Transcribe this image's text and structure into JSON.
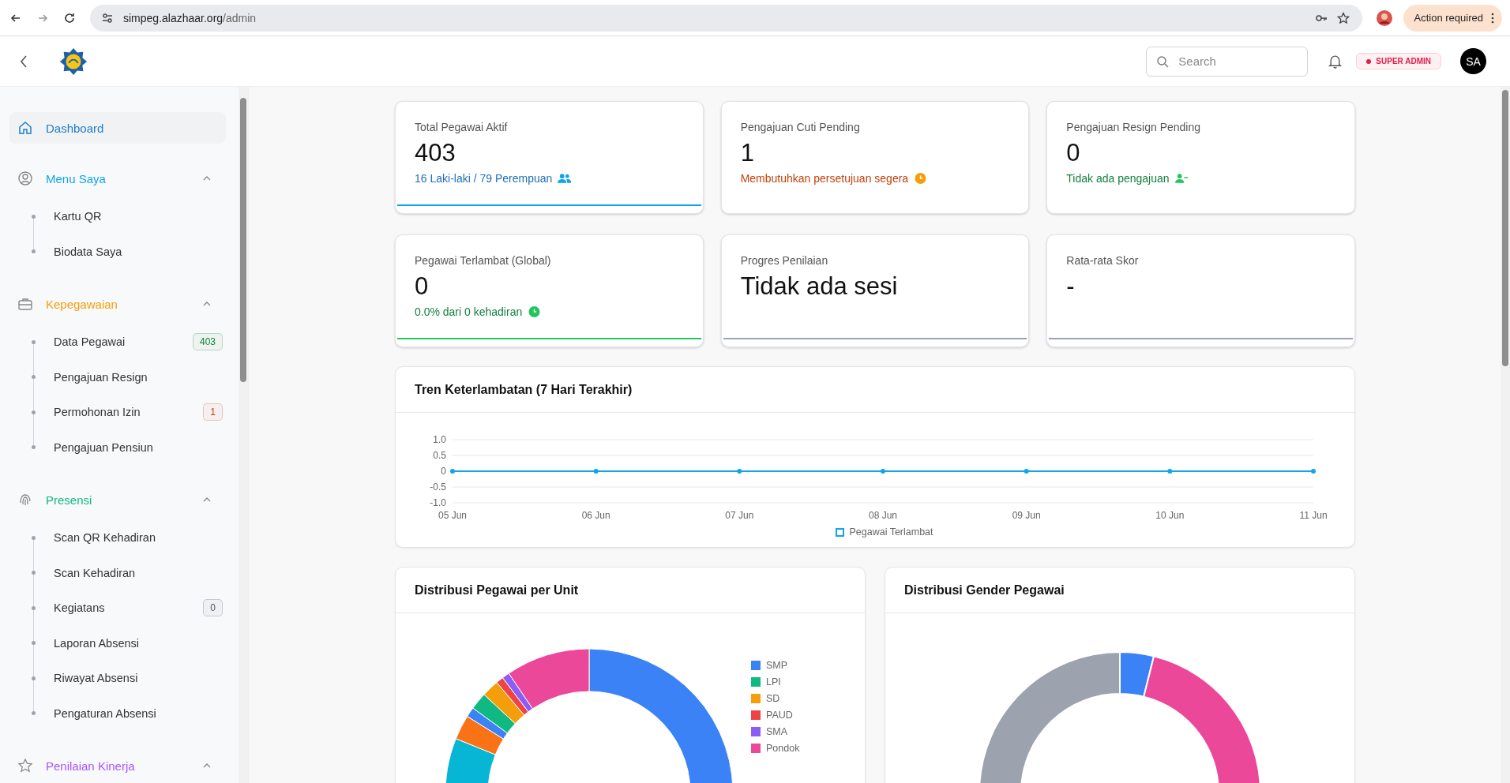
{
  "browser": {
    "url_host": "simpeg.alazhaar.org",
    "url_path": "/admin",
    "action_label": "Action required"
  },
  "header": {
    "search": {
      "placeholder": "Search"
    },
    "role_badge": "SUPER ADMIN",
    "avatar": "SA"
  },
  "sidebar": {
    "items": [
      {
        "kind": "link",
        "label": "Dashboard",
        "selected": true
      },
      {
        "kind": "group",
        "label": "Menu Saya",
        "color": "#0ea5e9",
        "expanded": true,
        "children": [
          {
            "label": "Kartu QR",
            "selected": false
          },
          {
            "label": "Biodata Saya",
            "selected": false
          }
        ]
      },
      {
        "kind": "group",
        "label": "Kepegawaian",
        "color": "#f59e0b",
        "expanded": true,
        "children": [
          {
            "label": "Data Pegawai",
            "selected": false,
            "badge": {
              "text": "403",
              "color": "#15803d"
            }
          },
          {
            "label": "Pengajuan Resign",
            "selected": false
          },
          {
            "label": "Permohonan Izin",
            "selected": false,
            "badge": {
              "text": "1",
              "color": "#c2410c"
            }
          },
          {
            "label": "Pengajuan Pensiun",
            "selected": false
          }
        ]
      },
      {
        "kind": "group",
        "label": "Presensi",
        "color": "#10b981",
        "expanded": true,
        "children": [
          {
            "label": "Scan QR Kehadiran",
            "selected": false
          },
          {
            "label": "Scan Kehadiran",
            "selected": false
          },
          {
            "label": "Kegiatans",
            "selected": false,
            "badge": {
              "text": "0",
              "color": "#4b5563"
            }
          },
          {
            "label": "Laporan Absensi",
            "selected": false
          },
          {
            "label": "Riwayat Absensi",
            "selected": false
          },
          {
            "label": "Pengaturan Absensi",
            "selected": false
          }
        ]
      },
      {
        "kind": "group",
        "label": "Penilaian Kinerja",
        "color": "#a855f7",
        "expanded": true
      }
    ]
  },
  "stats": [
    {
      "label": "Total Pegawai Aktif",
      "value": "403",
      "note": "16 Laki-laki / 79 Perempuan",
      "color": "#1d6fb8",
      "bar": {
        "level": 1,
        "color": "#0ea5e9"
      }
    },
    {
      "label": "Pengajuan Cuti Pending",
      "value": "1",
      "note": "Membutuhkan persetujuan segera",
      "color": "#c2410c"
    },
    {
      "label": "Pengajuan Resign Pending",
      "value": "0",
      "note": "Tidak ada pengajuan",
      "color": "#15803d"
    },
    {
      "label": "Pegawai Terlambat (Global)",
      "value": "0",
      "note": "0.0% dari 0 kehadiran",
      "color": "#15803d",
      "bar": {
        "level": 1,
        "color": "#22c55e"
      }
    },
    {
      "label": "Progres Penilaian",
      "value": "Tidak ada sesi",
      "bar": {
        "level": 1,
        "color": "#9ca3af"
      }
    },
    {
      "label": "Rata-rata Skor",
      "value": "-",
      "bar": {
        "level": 1,
        "color": "#9ca3af"
      }
    }
  ],
  "trend": {
    "title": "Tren Keterlambatan (7 Hari Terakhir)",
    "chart_data": {
      "type": "line",
      "categories": [
        "05 Jun",
        "06 Jun",
        "07 Jun",
        "08 Jun",
        "09 Jun",
        "10 Jun",
        "11 Jun"
      ],
      "series": [
        {
          "name": "Pegawai Terlambat",
          "color": "#0ea5e9",
          "marker": true,
          "values": [
            0,
            0,
            0,
            0,
            0,
            0,
            0
          ]
        }
      ],
      "ylim": [
        -1,
        1
      ],
      "yticks": [
        {
          "value": -1,
          "label": "-1.0"
        },
        {
          "value": -0.5,
          "label": "-0.5"
        },
        {
          "value": 0,
          "label": "0"
        },
        {
          "value": 0.5,
          "label": "0.5"
        },
        {
          "value": 1,
          "label": "1.0"
        }
      ]
    }
  },
  "unit_chart": {
    "title": "Distribusi Pegawai per Unit",
    "legend": [
      {
        "label": "SMP",
        "color": "#3b82f6"
      },
      {
        "label": "LPI",
        "color": "#10b981"
      },
      {
        "label": "SD",
        "color": "#f59e0b"
      },
      {
        "label": "PAUD",
        "color": "#ef4444"
      },
      {
        "label": "SMA",
        "color": "#8b5cf6"
      },
      {
        "label": "Pondok",
        "color": "#ec4899"
      }
    ]
  },
  "gender_chart": {
    "title": "Distribusi Gender Pegawai"
  }
}
